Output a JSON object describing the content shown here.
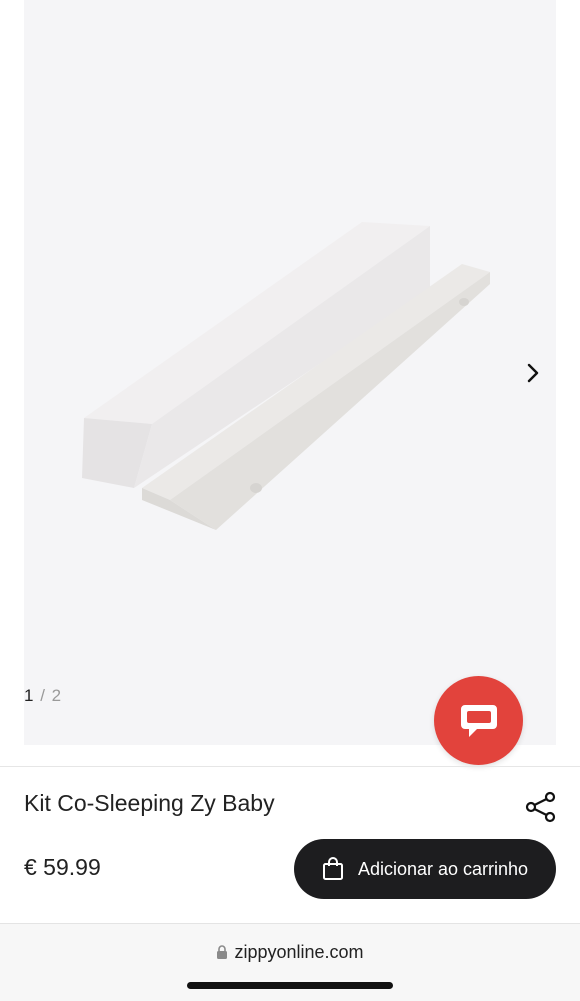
{
  "gallery": {
    "current": "1",
    "separator": " / ",
    "total": "2",
    "image_alt": "Kit Co-Sleeping Zy Baby product image",
    "next_icon": "chevron-right-icon"
  },
  "chat": {
    "icon": "chat-bubble-icon",
    "color": "#e2433c"
  },
  "product": {
    "title": "Kit Co-Sleeping Zy Baby",
    "price": "€ 59.99",
    "share_icon": "share-icon"
  },
  "cart": {
    "label": "Adicionar ao carrinho",
    "icon": "shopping-bag-icon"
  },
  "browser": {
    "url": "zippyonline.com",
    "lock_icon": "lock-icon"
  },
  "colors": {
    "accent": "#e2433c",
    "button": "#1d1d1f",
    "image_bg": "#f5f5f7"
  }
}
